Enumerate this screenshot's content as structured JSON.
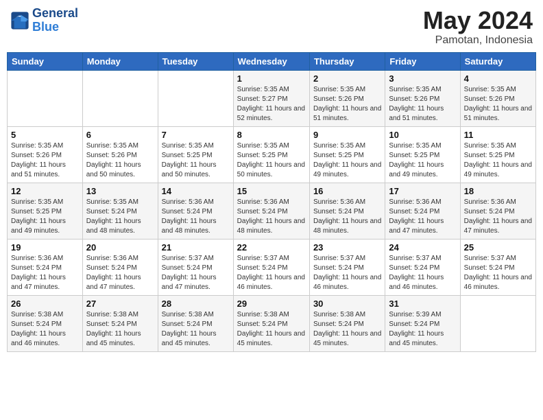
{
  "header": {
    "logo_line1": "General",
    "logo_line2": "Blue",
    "month": "May 2024",
    "location": "Pamotan, Indonesia"
  },
  "weekdays": [
    "Sunday",
    "Monday",
    "Tuesday",
    "Wednesday",
    "Thursday",
    "Friday",
    "Saturday"
  ],
  "weeks": [
    [
      {
        "day": "",
        "info": ""
      },
      {
        "day": "",
        "info": ""
      },
      {
        "day": "",
        "info": ""
      },
      {
        "day": "1",
        "info": "Sunrise: 5:35 AM\nSunset: 5:27 PM\nDaylight: 11 hours\nand 52 minutes."
      },
      {
        "day": "2",
        "info": "Sunrise: 5:35 AM\nSunset: 5:26 PM\nDaylight: 11 hours\nand 51 minutes."
      },
      {
        "day": "3",
        "info": "Sunrise: 5:35 AM\nSunset: 5:26 PM\nDaylight: 11 hours\nand 51 minutes."
      },
      {
        "day": "4",
        "info": "Sunrise: 5:35 AM\nSunset: 5:26 PM\nDaylight: 11 hours\nand 51 minutes."
      }
    ],
    [
      {
        "day": "5",
        "info": "Sunrise: 5:35 AM\nSunset: 5:26 PM\nDaylight: 11 hours\nand 51 minutes."
      },
      {
        "day": "6",
        "info": "Sunrise: 5:35 AM\nSunset: 5:26 PM\nDaylight: 11 hours\nand 50 minutes."
      },
      {
        "day": "7",
        "info": "Sunrise: 5:35 AM\nSunset: 5:25 PM\nDaylight: 11 hours\nand 50 minutes."
      },
      {
        "day": "8",
        "info": "Sunrise: 5:35 AM\nSunset: 5:25 PM\nDaylight: 11 hours\nand 50 minutes."
      },
      {
        "day": "9",
        "info": "Sunrise: 5:35 AM\nSunset: 5:25 PM\nDaylight: 11 hours\nand 49 minutes."
      },
      {
        "day": "10",
        "info": "Sunrise: 5:35 AM\nSunset: 5:25 PM\nDaylight: 11 hours\nand 49 minutes."
      },
      {
        "day": "11",
        "info": "Sunrise: 5:35 AM\nSunset: 5:25 PM\nDaylight: 11 hours\nand 49 minutes."
      }
    ],
    [
      {
        "day": "12",
        "info": "Sunrise: 5:35 AM\nSunset: 5:25 PM\nDaylight: 11 hours\nand 49 minutes."
      },
      {
        "day": "13",
        "info": "Sunrise: 5:35 AM\nSunset: 5:24 PM\nDaylight: 11 hours\nand 48 minutes."
      },
      {
        "day": "14",
        "info": "Sunrise: 5:36 AM\nSunset: 5:24 PM\nDaylight: 11 hours\nand 48 minutes."
      },
      {
        "day": "15",
        "info": "Sunrise: 5:36 AM\nSunset: 5:24 PM\nDaylight: 11 hours\nand 48 minutes."
      },
      {
        "day": "16",
        "info": "Sunrise: 5:36 AM\nSunset: 5:24 PM\nDaylight: 11 hours\nand 48 minutes."
      },
      {
        "day": "17",
        "info": "Sunrise: 5:36 AM\nSunset: 5:24 PM\nDaylight: 11 hours\nand 47 minutes."
      },
      {
        "day": "18",
        "info": "Sunrise: 5:36 AM\nSunset: 5:24 PM\nDaylight: 11 hours\nand 47 minutes."
      }
    ],
    [
      {
        "day": "19",
        "info": "Sunrise: 5:36 AM\nSunset: 5:24 PM\nDaylight: 11 hours\nand 47 minutes."
      },
      {
        "day": "20",
        "info": "Sunrise: 5:36 AM\nSunset: 5:24 PM\nDaylight: 11 hours\nand 47 minutes."
      },
      {
        "day": "21",
        "info": "Sunrise: 5:37 AM\nSunset: 5:24 PM\nDaylight: 11 hours\nand 47 minutes."
      },
      {
        "day": "22",
        "info": "Sunrise: 5:37 AM\nSunset: 5:24 PM\nDaylight: 11 hours\nand 46 minutes."
      },
      {
        "day": "23",
        "info": "Sunrise: 5:37 AM\nSunset: 5:24 PM\nDaylight: 11 hours\nand 46 minutes."
      },
      {
        "day": "24",
        "info": "Sunrise: 5:37 AM\nSunset: 5:24 PM\nDaylight: 11 hours\nand 46 minutes."
      },
      {
        "day": "25",
        "info": "Sunrise: 5:37 AM\nSunset: 5:24 PM\nDaylight: 11 hours\nand 46 minutes."
      }
    ],
    [
      {
        "day": "26",
        "info": "Sunrise: 5:38 AM\nSunset: 5:24 PM\nDaylight: 11 hours\nand 46 minutes."
      },
      {
        "day": "27",
        "info": "Sunrise: 5:38 AM\nSunset: 5:24 PM\nDaylight: 11 hours\nand 45 minutes."
      },
      {
        "day": "28",
        "info": "Sunrise: 5:38 AM\nSunset: 5:24 PM\nDaylight: 11 hours\nand 45 minutes."
      },
      {
        "day": "29",
        "info": "Sunrise: 5:38 AM\nSunset: 5:24 PM\nDaylight: 11 hours\nand 45 minutes."
      },
      {
        "day": "30",
        "info": "Sunrise: 5:38 AM\nSunset: 5:24 PM\nDaylight: 11 hours\nand 45 minutes."
      },
      {
        "day": "31",
        "info": "Sunrise: 5:39 AM\nSunset: 5:24 PM\nDaylight: 11 hours\nand 45 minutes."
      },
      {
        "day": "",
        "info": ""
      }
    ]
  ]
}
